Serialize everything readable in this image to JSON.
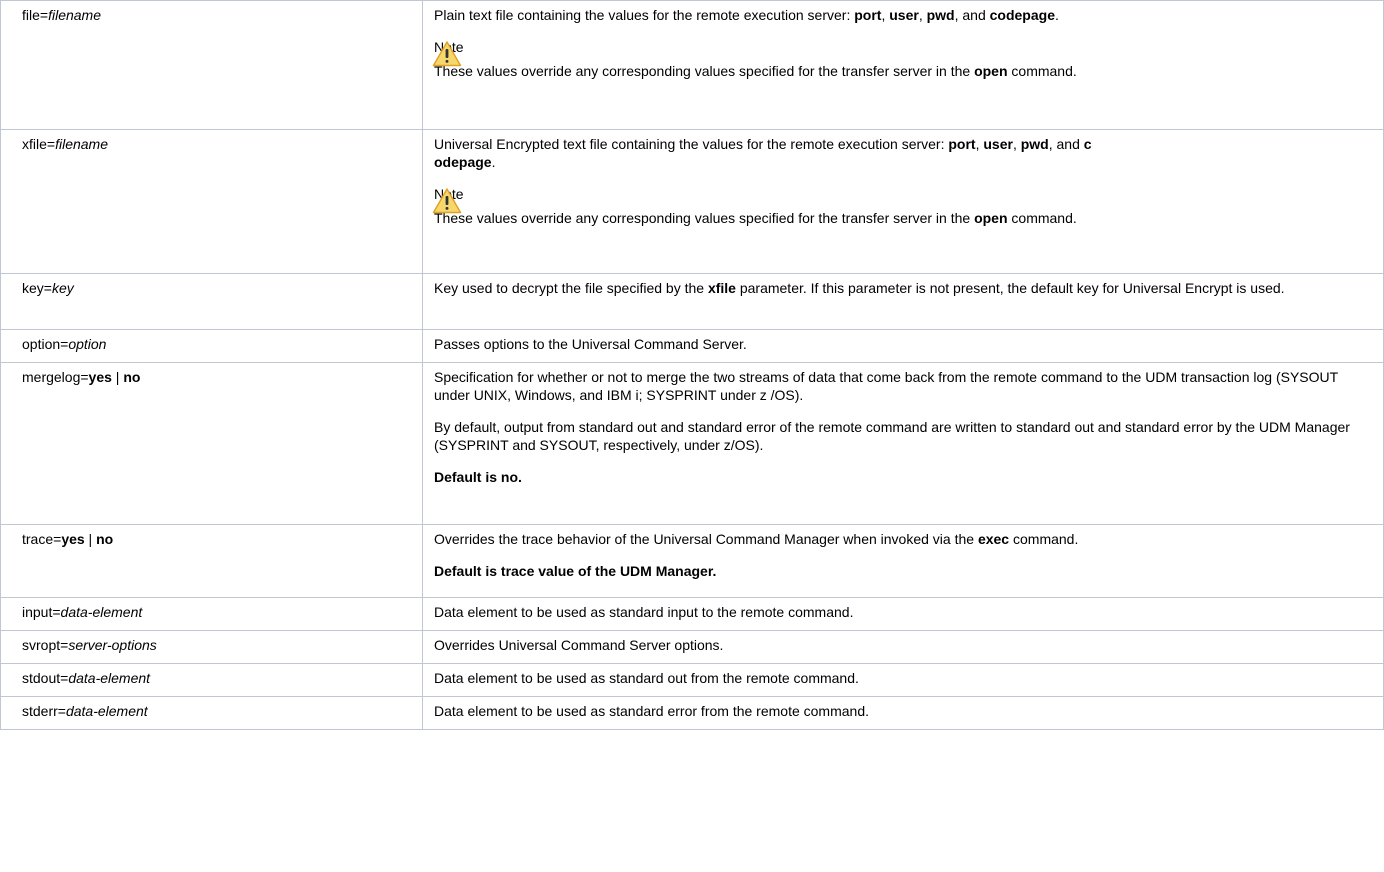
{
  "rows": [
    {
      "param": "file=",
      "param_arg": "filename",
      "desc_pre": "Plain text file containing the values for the remote execution server: ",
      "port": "port",
      "sep1": ", ",
      "user": "user",
      "sep2": ", ",
      "pwd": "pwd",
      "sep3": ", and ",
      "codepage": "codepage",
      "end": ".",
      "note_title": "Note",
      "note_pre": "These values override any corresponding values specified for the transfer server in the ",
      "note_cmd": "open",
      "note_post": " command."
    },
    {
      "param": "xfile=",
      "param_arg": "filename",
      "desc_pre": "Universal Encrypted text file containing the values for the remote execution server: ",
      "port": "port",
      "sep1": ", ",
      "user": "user",
      "sep2": ", ",
      "pwd": "pwd",
      "sep3": ", and ",
      "codepage_a": "c",
      "codepage_b": "odepage",
      "end": ".",
      "note_title": "Note",
      "note_pre": "These values override any corresponding values specified for the transfer server in the ",
      "note_cmd": "open",
      "note_post": " command."
    },
    {
      "param": "key=",
      "param_arg": "key",
      "desc_pre": "Key used to decrypt the file specified by the ",
      "desc_b": "xfile",
      "desc_post": " parameter. If this parameter is not present, the default key for Universal Encrypt is used."
    },
    {
      "param": "option=",
      "param_arg": "option",
      "desc": "Passes options to the Universal Command Server."
    },
    {
      "param": "mergelog=",
      "yes": "yes",
      "bar": " | ",
      "no": "no",
      "desc1": "Specification for whether or not to merge the two streams of data that come back from the remote command to the UDM transaction log (SYSOUT under UNIX, Windows, and IBM i; SYSPRINT under z /OS).",
      "desc2": "By default, output from standard out and standard error of the remote command are written to standard out and standard error by the UDM Manager (SYSPRINT and SYSOUT, respectively, under z/OS).",
      "default": "Default is no."
    },
    {
      "param": "trace=",
      "yes": "yes",
      "bar": " | ",
      "no": "no",
      "desc_pre": "Overrides the trace behavior of the Universal Command Manager when invoked via the ",
      "desc_b": "exec",
      "desc_post": " command.",
      "default": "Default is trace value of the UDM Manager."
    },
    {
      "param": "input=",
      "param_arg": "data-element",
      "desc": "Data element to be used as standard input to the remote command."
    },
    {
      "param": "svropt=",
      "param_arg": "server-options",
      "desc": "Overrides Universal Command Server options."
    },
    {
      "param": "stdout=",
      "param_arg": "data-element",
      "desc": "Data element to be used as standard out from the remote command."
    },
    {
      "param": "stderr=",
      "param_arg": "data-element",
      "desc": "Data element to be used as standard error from the remote command."
    }
  ],
  "icon": "warning-icon"
}
